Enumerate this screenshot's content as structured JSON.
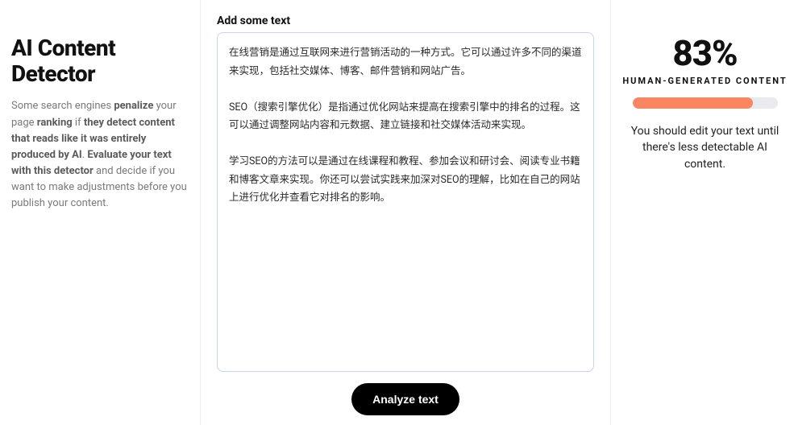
{
  "left": {
    "title": "AI Content Detector",
    "desc_parts": [
      "Some search engines ",
      "penalize",
      " your page ",
      "ranking",
      " if ",
      "they detect content that reads like it was entirely produced by AI",
      ". ",
      "Evaluate your text with this detector",
      " and decide if you want to make adjustments before you publish your content."
    ]
  },
  "center": {
    "label": "Add some text",
    "text": "在线营销是通过互联网来进行营销活动的一种方式。它可以通过许多不同的渠道来实现，包括社交媒体、博客、邮件营销和网站广告。\n\nSEO（搜索引擎优化）是指通过优化网站来提高在搜索引擎中的排名的过程。这可以通过调整网站内容和元数据、建立链接和社交媒体活动来实现。\n\n学习SEO的方法可以是通过在线课程和教程、参加会议和研讨会、阅读专业书籍和博客文章来实现。你还可以尝试实践来加深对SEO的理解，比如在自己的网站上进行优化并查看它对排名的影响。",
    "analyze_label": "Analyze text"
  },
  "right": {
    "score_value": 83,
    "score_display": "83%",
    "score_label": "HUMAN-GENERATED CONTENT",
    "bar_color": "#fb8661",
    "advice": "You should edit your text until there's less detectable AI content."
  }
}
